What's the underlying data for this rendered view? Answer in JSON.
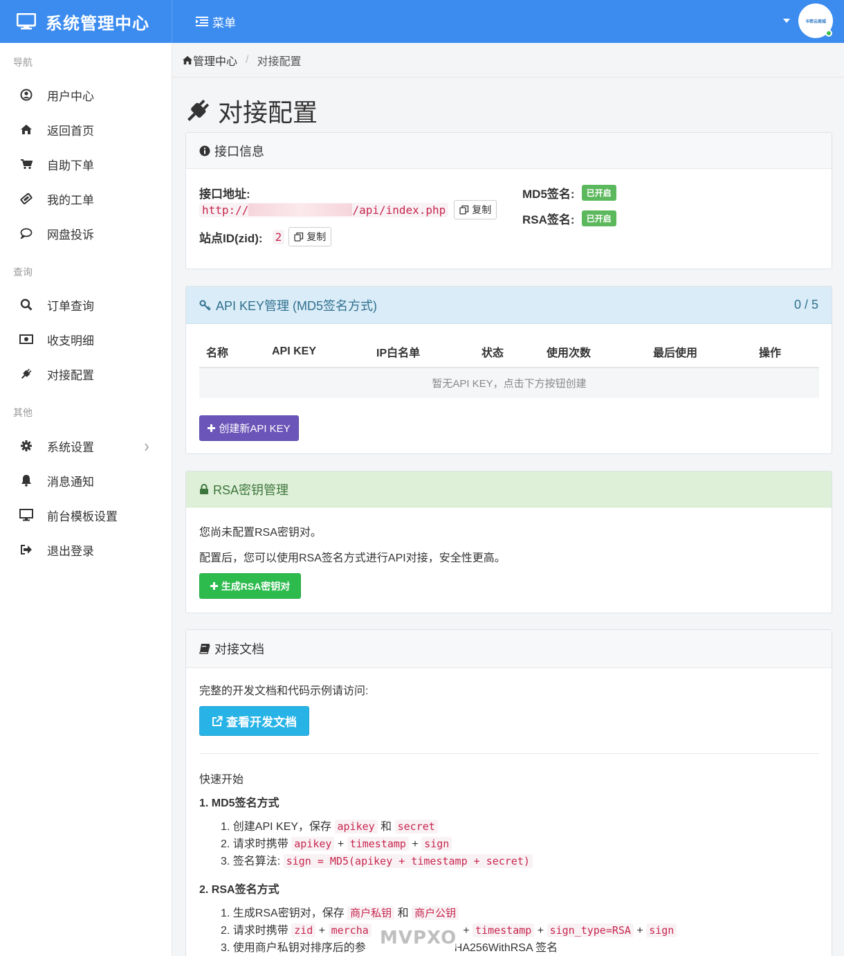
{
  "app": {
    "title": "系统管理中心",
    "menu_label": "菜单",
    "avatar_text": "卡密云商城"
  },
  "sidebar": {
    "sections": [
      {
        "title": "导航",
        "items": [
          {
            "label": "用户中心",
            "icon": "user-circle-icon"
          },
          {
            "label": "返回首页",
            "icon": "home-icon"
          },
          {
            "label": "自助下单",
            "icon": "cart-icon"
          },
          {
            "label": "我的工单",
            "icon": "ticket-icon"
          },
          {
            "label": "网盘投诉",
            "icon": "comment-icon"
          }
        ]
      },
      {
        "title": "查询",
        "items": [
          {
            "label": "订单查询",
            "icon": "search-icon"
          },
          {
            "label": "收支明细",
            "icon": "money-icon"
          },
          {
            "label": "对接配置",
            "icon": "plug-icon"
          }
        ]
      },
      {
        "title": "其他",
        "items": [
          {
            "label": "系统设置",
            "icon": "gear-icon"
          },
          {
            "label": "消息通知",
            "icon": "bell-icon"
          },
          {
            "label": "前台模板设置",
            "icon": "desktop-icon"
          },
          {
            "label": "退出登录",
            "icon": "logout-icon"
          }
        ]
      }
    ]
  },
  "breadcrumb": {
    "home": "管理中心",
    "current": "对接配置"
  },
  "page_title": "对接配置",
  "interface_panel": {
    "title": "接口信息",
    "address_label": "接口地址:",
    "address_prefix": "http://",
    "address_suffix": "/api/index.php",
    "copy_label": "复制",
    "zid_label": "站点ID(zid):",
    "zid_value": "2",
    "md5_label": "MD5签名:",
    "md5_status": "已开启",
    "rsa_label": "RSA签名:",
    "rsa_status": "已开启"
  },
  "apikey_panel": {
    "title": "API KEY管理 (MD5签名方式)",
    "count": "0 / 5",
    "columns": [
      "名称",
      "API KEY",
      "IP白名单",
      "状态",
      "使用次数",
      "最后使用",
      "操作"
    ],
    "empty_text": "暂无API KEY，点击下方按钮创建",
    "create_button": "创建新API KEY"
  },
  "rsa_panel": {
    "title": "RSA密钥管理",
    "line1": "您尚未配置RSA密钥对。",
    "line2": "配置后，您可以使用RSA签名方式进行API对接，安全性更高。",
    "generate_button": "生成RSA密钥对"
  },
  "docs_panel": {
    "title": "对接文档",
    "intro": "完整的开发文档和代码示例请访问:",
    "view_button": "查看开发文档",
    "quick_start": "快速开始",
    "md5_heading": "1. MD5签名方式",
    "md5_steps": {
      "s1_text": "1. 创建API KEY，保存",
      "s1_code1": "apikey",
      "s1_and": "和",
      "s1_code2": "secret",
      "s2_text": "2. 请求时携带",
      "s2_code1": "apikey",
      "s2_code2": "timestamp",
      "s2_code3": "sign",
      "plus": "+",
      "s3_text": "3. 签名算法:",
      "s3_code": "sign = MD5(apikey + timestamp + secret)"
    },
    "rsa_heading": "2. RSA签名方式",
    "rsa_steps": {
      "s1_text": "1. 生成RSA密钥对，保存",
      "s1_code1": "商户私钥",
      "s1_and": "和",
      "s1_code2": "商户公钥",
      "s2_text": "2. 请求时携带",
      "s2_code1": "zid",
      "s2_code2": "mercha",
      "s2_code3": "timestamp",
      "s2_code4": "sign_type=RSA",
      "s2_code5": "sign",
      "plus": "+",
      "s3_text_a": "3. 使用商户私钥对排序后的参",
      "s3_text_b": "HA256WithRSA 签名"
    }
  },
  "watermark": "MVPXO"
}
